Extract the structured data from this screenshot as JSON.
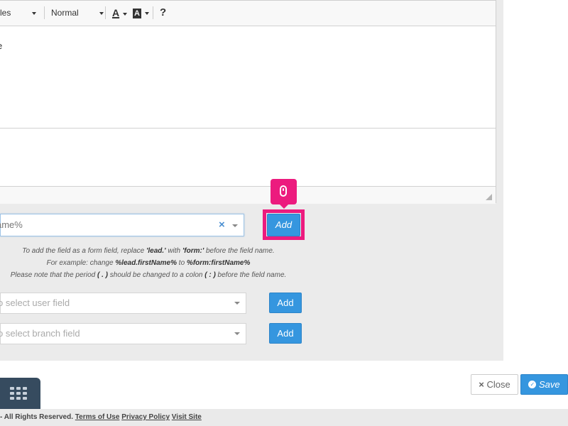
{
  "toolbar": {
    "styles_label": "les",
    "format_label": "Normal",
    "text_color_icon": "A",
    "bg_color_icon": "A",
    "help_label": "?"
  },
  "editor": {
    "content_text": "e"
  },
  "lead_field": {
    "value": "ame%",
    "clear_symbol": "×",
    "add_label": "Add"
  },
  "help": {
    "line1_pre": "To add the field as a form field, replace ",
    "line1_b1": "'lead.'",
    "line1_mid": " with ",
    "line1_b2": "'form:'",
    "line1_post": " before the field name.",
    "line2_pre": "For example: change ",
    "line2_b1": "%lead.firstName%",
    "line2_mid": " to ",
    "line2_b2": "%form:firstName%",
    "line3_pre": "Please note that the period ",
    "line3_b1": "( . )",
    "line3_mid": " should be changed to a colon ",
    "line3_b2": "( : )",
    "line3_post": " before the field name."
  },
  "user_field": {
    "placeholder": "o select user field",
    "add_label": "Add"
  },
  "branch_field": {
    "placeholder": "o select branch field",
    "add_label": "Add"
  },
  "footer": {
    "close_label": "Close",
    "close_icon": "×",
    "save_label": "Save",
    "copyright": "- All Rights Reserved.",
    "terms_link": "Terms of Use",
    "privacy_link": "Privacy Policy",
    "visit_link": "Visit Site"
  },
  "colors": {
    "accent": "#3596df",
    "highlight": "#ec1b7e",
    "apps_button": "#364b5f"
  }
}
